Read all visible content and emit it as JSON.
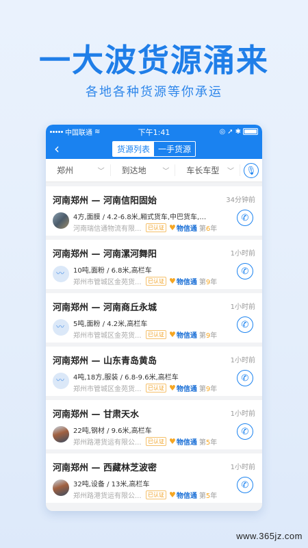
{
  "promo": {
    "title": "一大波货源涌来",
    "subtitle": "各地各种货源等你承运"
  },
  "status_bar": {
    "carrier": "中国联通",
    "time": "下午1:41"
  },
  "nav": {
    "tab_active": "货源列表",
    "tab_inactive": "一手货源"
  },
  "filters": {
    "origin": "郑州",
    "destination": "到达地",
    "vehicle": "车长车型"
  },
  "badges": {
    "verified": "已认证",
    "brand": "物信通"
  },
  "listings": [
    {
      "route": "河南郑州 — 河南信阳固始",
      "time": "34分钟前",
      "spec": "4方,面膜 / 4.2-6.8米,厢式货车,中巴货车,高...",
      "company": "河南瑞信通物流有限...",
      "years_prefix": "第",
      "years": "6",
      "years_suffix": "年"
    },
    {
      "route": "河南郑州 — 河南漯河舞阳",
      "time": "1小时前",
      "spec": "10吨,面粉 / 6.8米,高栏车",
      "company": "郑州市管城区金苑货...",
      "years_prefix": "第",
      "years": "9",
      "years_suffix": "年"
    },
    {
      "route": "河南郑州 — 河南商丘永城",
      "time": "1小时前",
      "spec": "5吨,面粉 / 4.2米,高栏车",
      "company": "郑州市管城区金苑货...",
      "years_prefix": "第",
      "years": "9",
      "years_suffix": "年"
    },
    {
      "route": "河南郑州 — 山东青岛黄岛",
      "time": "1小时前",
      "spec": "4吨,18方,服装 / 6.8-9.6米,高栏车",
      "company": "郑州市管城区金苑货...",
      "years_prefix": "第",
      "years": "9",
      "years_suffix": "年"
    },
    {
      "route": "河南郑州 — 甘肃天水",
      "time": "1小时前",
      "spec": "22吨,钢材 / 9.6米,高栏车",
      "company": "郑州路港货运有限公...",
      "years_prefix": "第",
      "years": "5",
      "years_suffix": "年"
    },
    {
      "route": "河南郑州 — 西藏林芝波密",
      "time": "1小时前",
      "spec": "32吨,设备 / 13米,高栏车",
      "company": "郑州路港货运有限公...",
      "years_prefix": "第",
      "years": "5",
      "years_suffix": "年"
    }
  ],
  "watermark": "www.365jz.com",
  "colors": {
    "accent": "#1a82f0",
    "title": "#1f7ee8",
    "badge": "#f5a623"
  }
}
